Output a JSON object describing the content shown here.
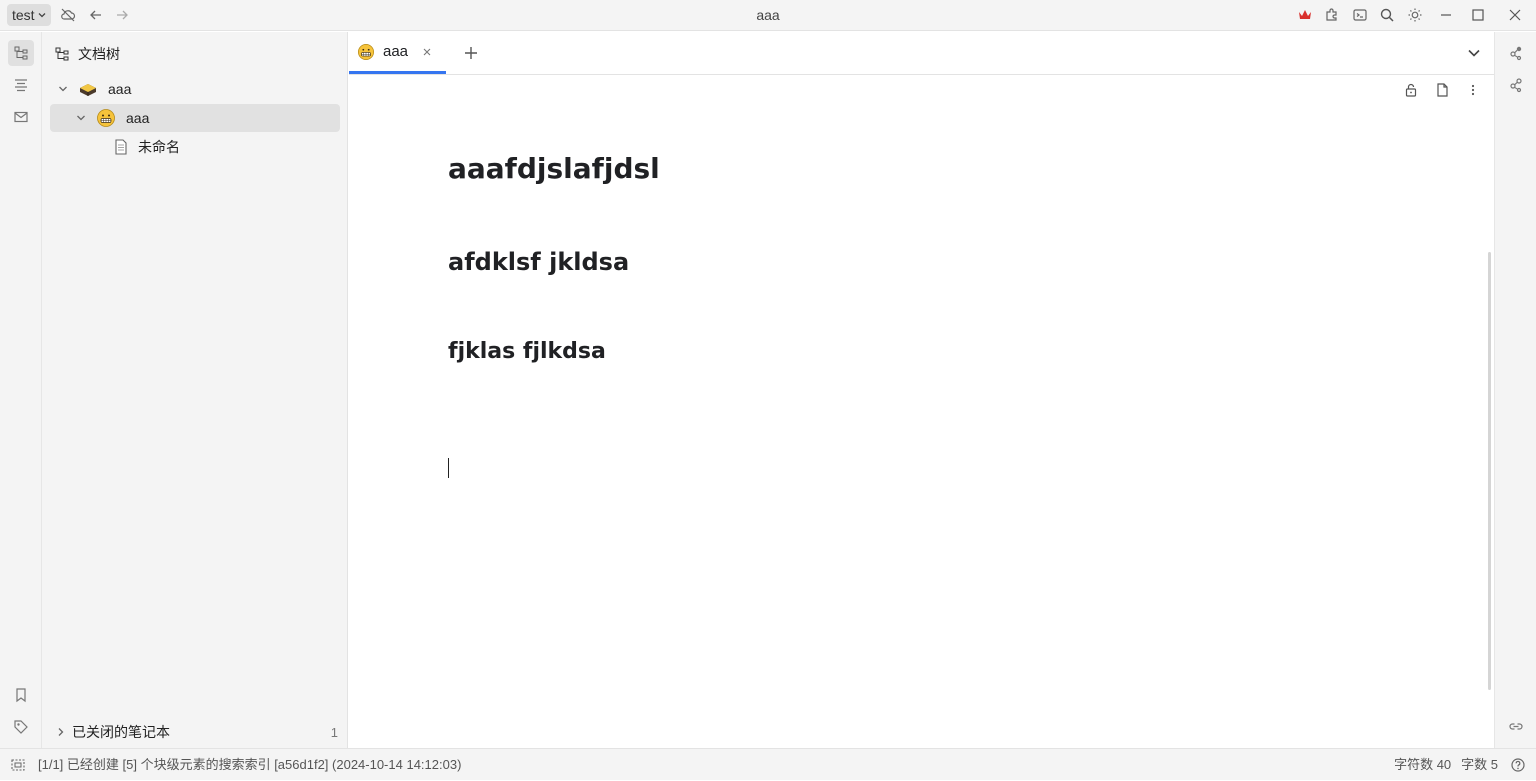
{
  "titlebar": {
    "workspace": "test",
    "window_title": "aaa"
  },
  "sidebar": {
    "title": "文档树",
    "tree": [
      {
        "label": "aaa",
        "icon": "notebook-emoji-icon"
      },
      {
        "label": "aaa",
        "icon": "grimacing-face-emoji-icon"
      },
      {
        "label": "未命名",
        "icon": "document-icon"
      }
    ],
    "closed_notebooks": {
      "label": "已关闭的笔记本",
      "count": "1"
    }
  },
  "tabs": [
    {
      "label": "aaa",
      "icon": "grimacing-face-emoji-icon",
      "active": true
    }
  ],
  "editor": {
    "heading1": "aaafdjslafjdsl",
    "heading2": "afdklsf jkldsa",
    "heading3": "fjklas fjlkdsa"
  },
  "status": {
    "message": "[1/1] 已经创建 [5] 个块级元素的搜索索引 [a56d1f2] (2024-10-14 14:12:03)",
    "char_count": "字符数 40",
    "word_count": "字数 5"
  },
  "colors": {
    "accent": "#3575f0",
    "crown": "#d9302c"
  }
}
